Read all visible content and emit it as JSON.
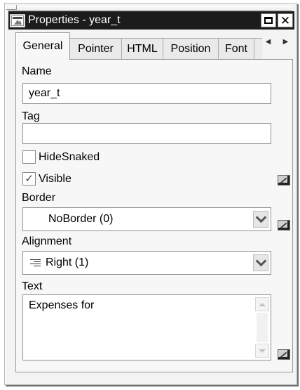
{
  "window": {
    "title": "Properties -  year_t",
    "icons": {
      "app": "properties-window-icon",
      "restore": "restore-icon",
      "close": "close-icon"
    }
  },
  "tabs": [
    {
      "label": "General",
      "active": true
    },
    {
      "label": "Pointer",
      "active": false
    },
    {
      "label": "HTML",
      "active": false
    },
    {
      "label": "Position",
      "active": false
    },
    {
      "label": "Font",
      "active": false
    }
  ],
  "tab_scroll": {
    "left": "◀",
    "right": "▶"
  },
  "general": {
    "name_label": "Name",
    "name_value": "year_t",
    "tag_label": "Tag",
    "tag_value": "",
    "hidesnaked_label": "HideSnaked",
    "hidesnaked_checked": false,
    "visible_label": "Visible",
    "visible_checked": true,
    "check_mark": "✓",
    "border_label": "Border",
    "border_value": "NoBorder (0)",
    "alignment_label": "Alignment",
    "alignment_value": "Right (1)",
    "alignment_icon": "align-right-icon",
    "text_label": "Text",
    "text_value": "Expenses for"
  },
  "colors": {
    "titlebar": "#1c1c1c",
    "panel": "#f7f7f7",
    "window": "#f3f3f3"
  }
}
